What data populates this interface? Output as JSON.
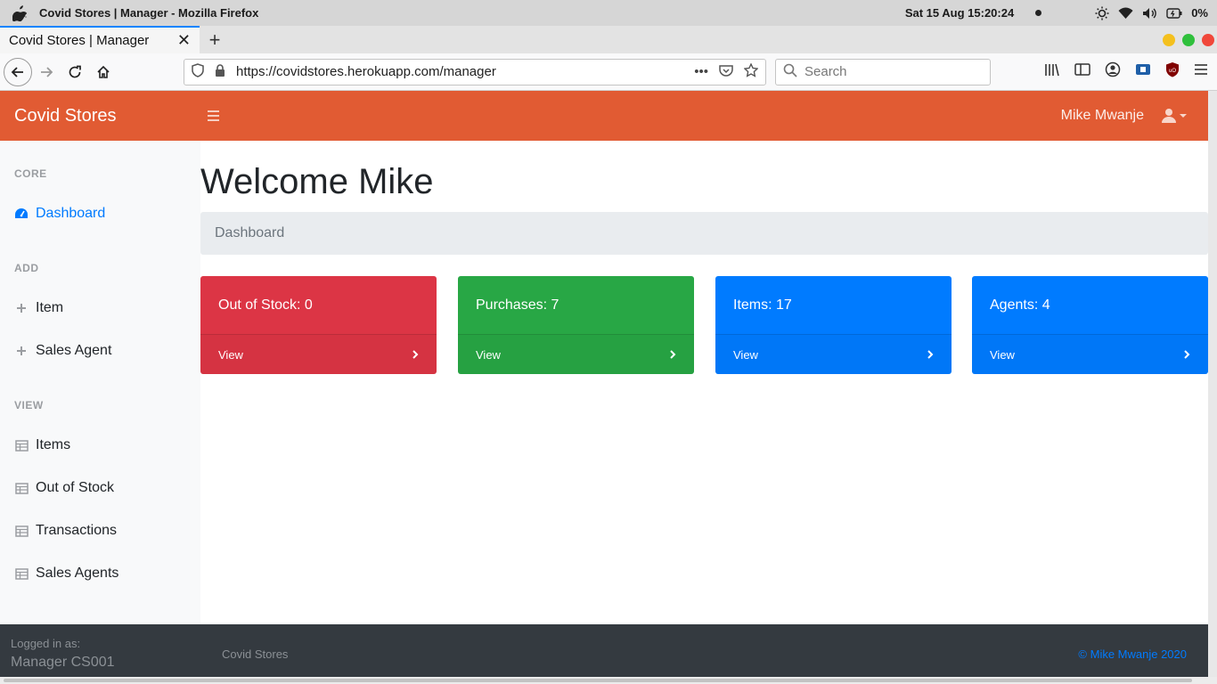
{
  "os": {
    "window_title": "Covid Stores | Manager - Mozilla Firefox",
    "clock": "Sat 15 Aug  15:20:24",
    "battery": "0%"
  },
  "browser": {
    "tab_title": "Covid Stores | Manager",
    "url": "https://covidstores.herokuapp.com/manager",
    "search_placeholder": "Search"
  },
  "header": {
    "brand": "Covid Stores",
    "user_name": "Mike Mwanje"
  },
  "sidebar": {
    "core_heading": "CORE",
    "dashboard": "Dashboard",
    "add_heading": "ADD",
    "add_items": [
      "Item",
      "Sales Agent"
    ],
    "view_heading": "VIEW",
    "view_items": [
      "Items",
      "Out of Stock",
      "Transactions",
      "Sales Agents"
    ]
  },
  "main": {
    "welcome": "Welcome Mike",
    "breadcrumb": "Dashboard",
    "cards": [
      {
        "label": "Out of Stock: 0",
        "footer": "View",
        "color": "#dc3545"
      },
      {
        "label": "Purchases: 7",
        "footer": "View",
        "color": "#28a745"
      },
      {
        "label": "Items: 17",
        "footer": "View",
        "color": "#007bff"
      },
      {
        "label": "Agents: 4",
        "footer": "View",
        "color": "#007bff"
      }
    ]
  },
  "footer": {
    "logged_label": "Logged in as:",
    "logged_value": "Manager CS001",
    "brand": "Covid Stores",
    "copyright": "© Mike Mwanje 2020"
  },
  "colors": {
    "header": "#e15b33",
    "active": "#007bff",
    "footer": "#343a40"
  }
}
